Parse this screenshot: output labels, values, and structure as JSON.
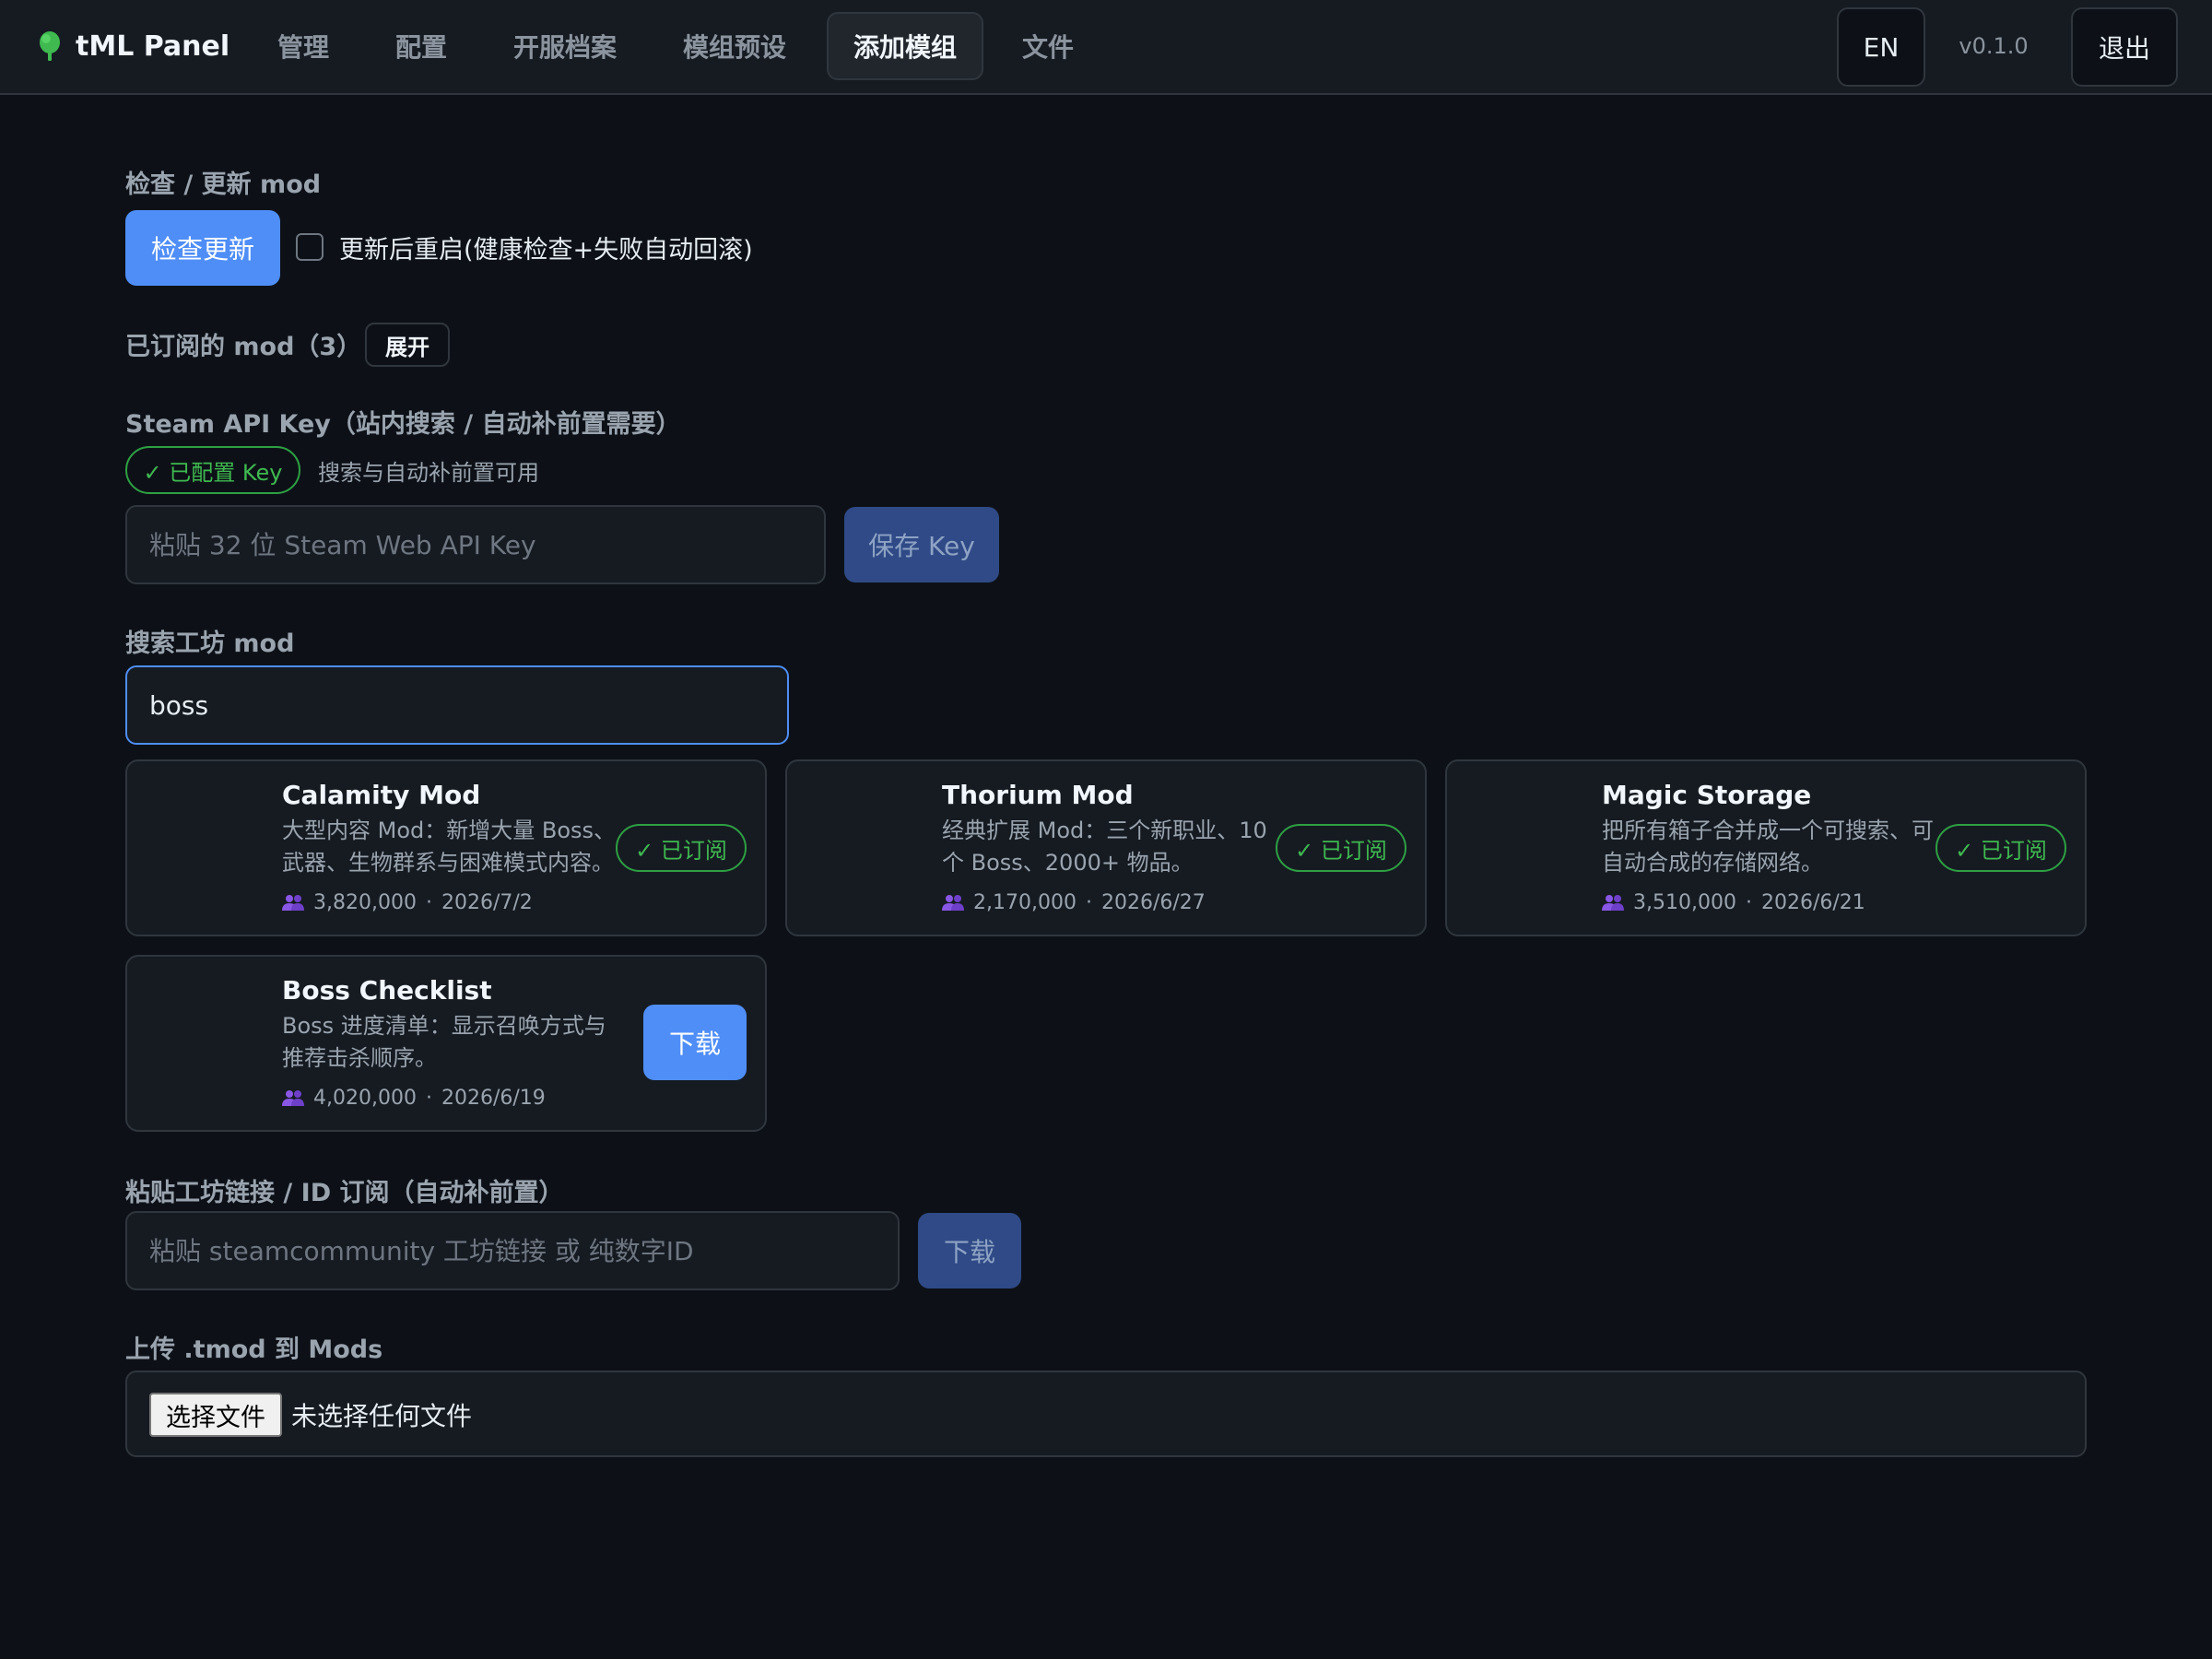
{
  "app": {
    "brand": "tML Panel",
    "brand_icon": "tree-icon"
  },
  "nav": {
    "items": [
      {
        "label": "管理"
      },
      {
        "label": "配置"
      },
      {
        "label": "开服档案"
      },
      {
        "label": "模组预设"
      },
      {
        "label": "添加模组",
        "active": true
      },
      {
        "label": "文件"
      }
    ],
    "lang_label": "EN",
    "version": "v0.1.0",
    "logout_label": "退出"
  },
  "check_update": {
    "section_label": "检查 / 更新 mod",
    "button_label": "检查更新",
    "restart_checkbox_label": "更新后重启(健康检查+失败自动回滚)",
    "restart_checked": false
  },
  "subscribed": {
    "label": "已订阅的 mod（3）",
    "expand_label": "展开"
  },
  "api_key": {
    "section_label": "Steam API Key（站内搜索 / 自动补前置需要）",
    "status_badge": "✓ 已配置 Key",
    "status_hint": "搜索与自动补前置可用",
    "input_placeholder": "粘贴 32 位 Steam Web API Key",
    "input_value": "",
    "save_label": "保存 Key"
  },
  "search": {
    "section_label": "搜索工坊 mod",
    "query": "boss",
    "results": [
      {
        "title": "Calamity Mod",
        "desc": "大型内容 Mod：新增大量 Boss、武器、生物群系与困难模式内容。",
        "subs": "3,820,000",
        "date": "2026/7/2",
        "status": "subscribed",
        "badge": "✓ 已订阅"
      },
      {
        "title": "Thorium Mod",
        "desc": "经典扩展 Mod：三个新职业、10 个 Boss、2000+ 物品。",
        "subs": "2,170,000",
        "date": "2026/6/27",
        "status": "subscribed",
        "badge": "✓ 已订阅"
      },
      {
        "title": "Magic Storage",
        "desc": "把所有箱子合并成一个可搜索、可自动合成的存储网络。",
        "subs": "3,510,000",
        "date": "2026/6/21",
        "status": "subscribed",
        "badge": "✓ 已订阅"
      },
      {
        "title": "Boss Checklist",
        "desc": "Boss 进度清单：显示召唤方式与推荐击杀顺序。",
        "subs": "4,020,000",
        "date": "2026/6/19",
        "status": "available",
        "download_label": "下载"
      }
    ]
  },
  "link_subscribe": {
    "section_label": "粘贴工坊链接 / ID 订阅（自动补前置）",
    "input_placeholder": "粘贴 steamcommunity 工坊链接 或 纯数字ID",
    "input_value": "",
    "button_label": "下载"
  },
  "upload": {
    "section_label": "上传 .tmod 到 Mods",
    "choose_label": "选择文件",
    "no_file_text": "未选择任何文件"
  },
  "colors": {
    "background": "#0d1117",
    "surface": "#161b22",
    "border": "#30363d",
    "accent": "#4f8ef7",
    "success": "#3fb950",
    "brand_green": "#3fb950",
    "users_icon": "#8957e5"
  }
}
